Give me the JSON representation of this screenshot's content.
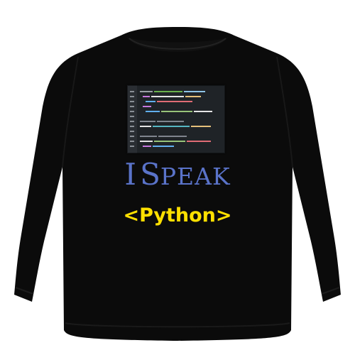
{
  "product": {
    "garment": "black crewneck sweatshirt",
    "garment_color": "#0b0b0b",
    "background_color": "#ffffff"
  },
  "print": {
    "image": "code-editor-photo",
    "headline_first": "I",
    "headline_second_initial": "S",
    "headline_second_rest": "PEAK",
    "headline_color": "#5a73c9",
    "subline": "<Python>",
    "subline_color": "#ffe000"
  }
}
